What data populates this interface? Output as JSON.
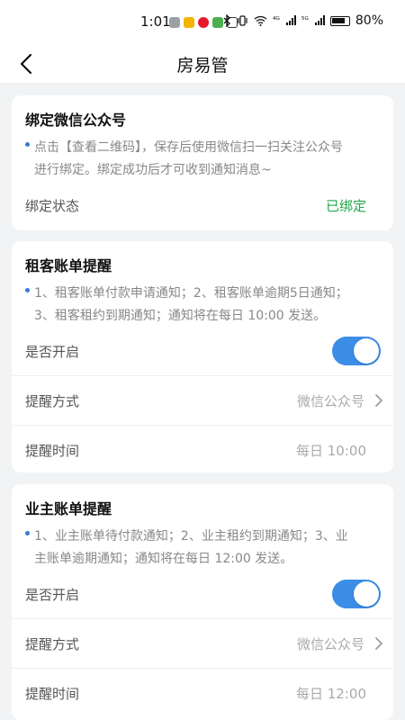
{
  "status_bar": {
    "time": "1:01",
    "signal_4g": "⁴ᴳ",
    "signal_5g": "⁵ᴳ",
    "battery": "80%"
  },
  "nav": {
    "title": "房易管"
  },
  "wechat_card": {
    "title": "绑定微信公众号",
    "desc_line1": "点击【查看二维码】，保存后使用微信扫一扫关注公众号",
    "desc_line2": "进行绑定。绑定成功后才可收到通知消息~",
    "status_label": "绑定状态",
    "status_value": "已绑定",
    "status_color": "#21a84a"
  },
  "tenant_card": {
    "title": "租客账单提醒",
    "desc_line1": "1、租客账单付款申请通知；2、租客账单逾期5日通知；",
    "desc_line2": "3、租客租约到期通知；通知将在每日 10:00 发送。",
    "enable_label": "是否开启",
    "enabled": true,
    "method_label": "提醒方式",
    "method_value": "微信公众号",
    "time_label": "提醒时间",
    "time_value": "每日 10:00"
  },
  "owner_card": {
    "title": "业主账单提醒",
    "desc_line1": "1、业主账单待付款通知；2、业主租约到期通知；3、业",
    "desc_line2": "主账单逾期通知；通知将在每日 12:00 发送。",
    "enable_label": "是否开启",
    "enabled": true,
    "method_label": "提醒方式",
    "method_value": "微信公众号",
    "time_label": "提醒时间",
    "time_value": "每日 12:00"
  },
  "colors": {
    "accent": "#3b8de6",
    "background": "#f2f3f5"
  }
}
